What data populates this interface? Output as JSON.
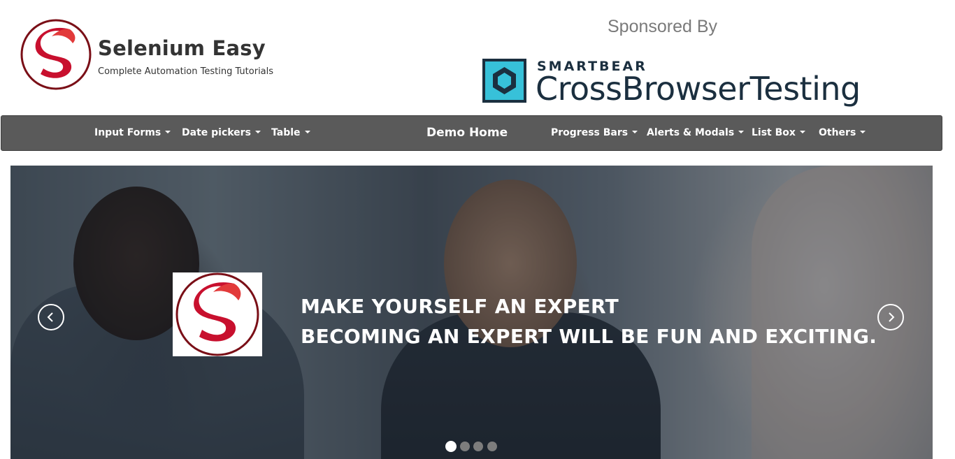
{
  "brand": {
    "name": "Selenium Easy",
    "tagline": "Complete Automation Testing Tutorials",
    "accent_color": "#c8102e"
  },
  "sponsor": {
    "label": "Sponsored By",
    "company": "SMARTBEAR",
    "product": "CrossBrowserTesting",
    "icon": "crossbrowsertesting-logo-icon",
    "icon_color": "#37c1d9"
  },
  "navbar": {
    "background": "#5a5a5a",
    "items": [
      {
        "label": "Input Forms",
        "dropdown": true
      },
      {
        "label": "Date pickers",
        "dropdown": true
      },
      {
        "label": "Table",
        "dropdown": true
      },
      {
        "label": "Demo Home",
        "dropdown": false
      },
      {
        "label": "Progress Bars",
        "dropdown": true
      },
      {
        "label": "Alerts & Modals",
        "dropdown": true
      },
      {
        "label": "List Box",
        "dropdown": true
      },
      {
        "label": "Others",
        "dropdown": true
      }
    ]
  },
  "carousel": {
    "heading_line1": "MAKE YOURSELF AN EXPERT",
    "heading_line2": "BECOMING AN EXPERT WILL BE FUN AND EXCITING.",
    "prev_icon": "chevron-left-icon",
    "next_icon": "chevron-right-icon",
    "indicator_count": 4,
    "active_indicator": 1
  }
}
